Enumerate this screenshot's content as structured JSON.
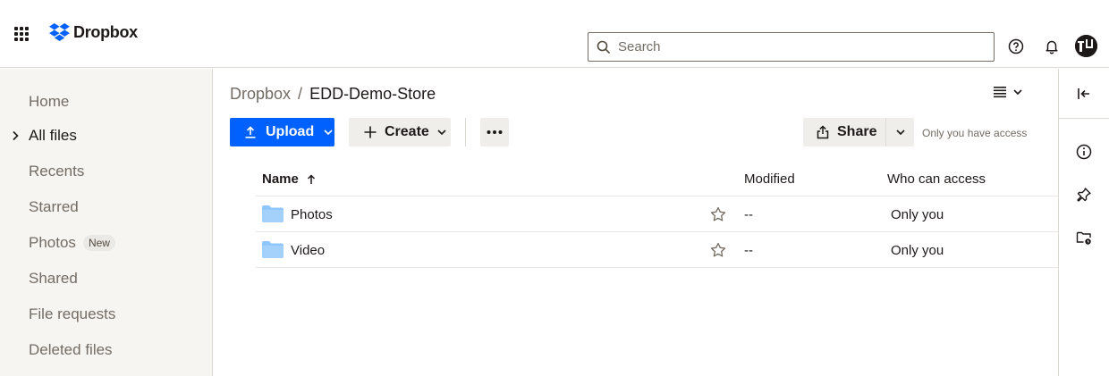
{
  "header": {
    "logo_text": "Dropbox",
    "search_placeholder": "Search"
  },
  "sidebar": {
    "items": [
      {
        "label": "Home",
        "active": false
      },
      {
        "label": "All files",
        "active": true
      },
      {
        "label": "Recents",
        "active": false
      },
      {
        "label": "Starred",
        "active": false
      },
      {
        "label": "Photos",
        "active": false,
        "badge": "New"
      },
      {
        "label": "Shared",
        "active": false
      },
      {
        "label": "File requests",
        "active": false
      },
      {
        "label": "Deleted files",
        "active": false
      }
    ]
  },
  "breadcrumb": {
    "root": "Dropbox",
    "separator": "/",
    "current": "EDD-Demo-Store"
  },
  "toolbar": {
    "upload_label": "Upload",
    "create_label": "Create",
    "share_label": "Share",
    "access_note": "Only you have access"
  },
  "table": {
    "columns": {
      "name": "Name",
      "modified": "Modified",
      "who": "Who can access"
    },
    "rows": [
      {
        "name": "Photos",
        "modified": "--",
        "who": "Only you"
      },
      {
        "name": "Video",
        "modified": "--",
        "who": "Only you"
      }
    ]
  },
  "colors": {
    "accent": "#0061fe",
    "folder": "#8fc6fb",
    "sidebar_bg": "#f7f5f2"
  }
}
